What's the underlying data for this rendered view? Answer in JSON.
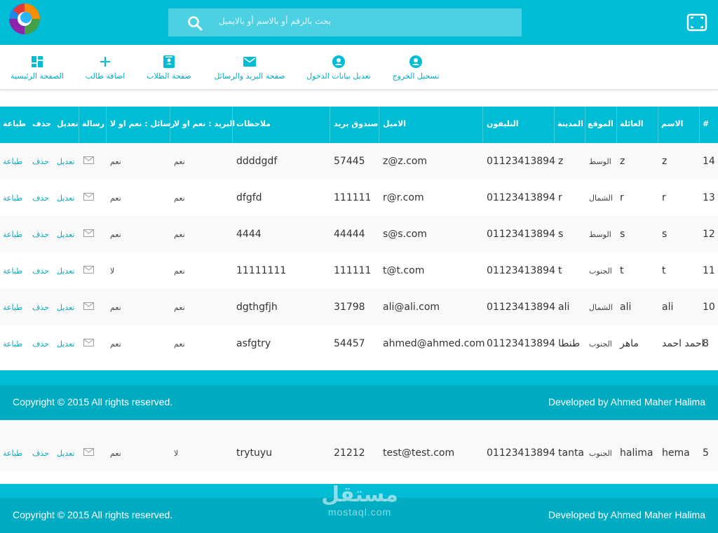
{
  "header": {
    "search_placeholder": "بحث بالرقم أو بالاسم أو بالايميل",
    "accent": "#00bcd4"
  },
  "nav": [
    {
      "label": "تسجيل الخروج",
      "icon": "account-circle-icon"
    },
    {
      "label": "تعديل بيانات الدخول",
      "icon": "account-circle-icon"
    },
    {
      "label": "صفحة البريد والرسائل",
      "icon": "mail-icon"
    },
    {
      "label": "صفحة الطلاب",
      "icon": "contacts-icon"
    },
    {
      "label": "اضافة طالب",
      "icon": "plus-icon"
    },
    {
      "label": "الصفحة الرئيسية",
      "icon": "dashboard-icon"
    }
  ],
  "table": {
    "columns": {
      "num": "#",
      "name": "الاسم",
      "family": "العائلة",
      "location": "الموقع",
      "city": "المدينة",
      "phone": "التليفون",
      "email": "الاميل",
      "pobox": "صندوق بريد",
      "notes": "ملاحظات",
      "mail_flag": "البريد : نعم او لا",
      "msg_flag": "رسائل : نعم او لا",
      "message": "رسالة",
      "edit": "تعديل",
      "delete": "حذف",
      "print": "طباعة"
    },
    "rows": [
      {
        "num": "14",
        "name": "z",
        "family": "z",
        "location": "الوسط",
        "city": "z",
        "phone": "01123413894",
        "email": "z@z.com",
        "pobox": "57445",
        "notes": "ddddgdf",
        "mail_flag": "نعم",
        "msg_flag": "نعم"
      },
      {
        "num": "13",
        "name": "r",
        "family": "r",
        "location": "الشمال",
        "city": "r",
        "phone": "01123413894",
        "email": "r@r.com",
        "pobox": "111111",
        "notes": "dfgfd",
        "mail_flag": "نعم",
        "msg_flag": "نعم"
      },
      {
        "num": "12",
        "name": "s",
        "family": "s",
        "location": "الوسط",
        "city": "s",
        "phone": "01123413894",
        "email": "s@s.com",
        "pobox": "44444",
        "notes": "4444",
        "mail_flag": "نعم",
        "msg_flag": "نعم"
      },
      {
        "num": "11",
        "name": "t",
        "family": "t",
        "location": "الجنوب",
        "city": "t",
        "phone": "01123413894",
        "email": "t@t.com",
        "pobox": "111111",
        "notes": "11111111",
        "mail_flag": "نعم",
        "msg_flag": "لا"
      },
      {
        "num": "10",
        "name": "ali",
        "family": "ali",
        "location": "الشمال",
        "city": "ali",
        "phone": "01123413894",
        "email": "ali@ali.com",
        "pobox": "31798",
        "notes": "dgthgfjh",
        "mail_flag": "نعم",
        "msg_flag": "نعم"
      },
      {
        "num": "8",
        "name": "احمد احمد",
        "family": "ماهر",
        "location": "الجنوب",
        "city": "طنطا",
        "phone": "01123413894",
        "email": "ahmed@ahmed.com",
        "pobox": "54457",
        "notes": "asfgtry",
        "mail_flag": "نعم",
        "msg_flag": "نعم"
      },
      {
        "num": "5",
        "name": "hema",
        "family": "halima",
        "location": "الجنوب",
        "city": "tanta",
        "phone": "01123413894",
        "email": "test@test.com",
        "pobox": "21212",
        "notes": "trytuyu",
        "mail_flag": "لا",
        "msg_flag": "نعم"
      }
    ]
  },
  "footer": {
    "copyright": "Copyright © 2015 All rights reserved.",
    "developer": "Developed by Ahmed Maher Halima"
  },
  "watermark": {
    "arabic": "مستقل",
    "latin": "mostaql.com"
  }
}
